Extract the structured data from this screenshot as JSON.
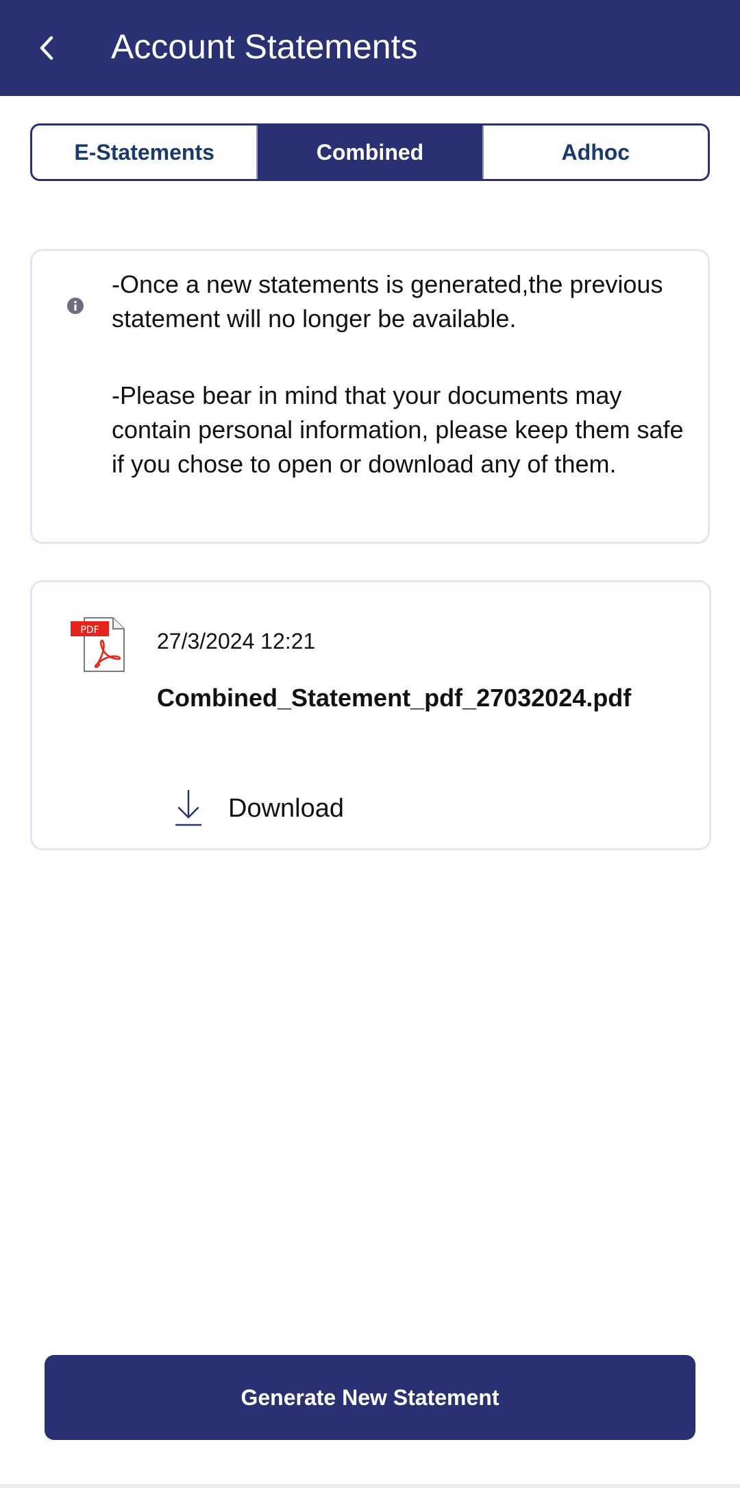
{
  "header": {
    "title": "Account Statements",
    "back_icon": "chevron-left-icon",
    "background": "#2a3172"
  },
  "tabs": [
    {
      "label": "E-Statements",
      "active": false
    },
    {
      "label": "Combined",
      "active": true
    },
    {
      "label": "Adhoc",
      "active": false
    }
  ],
  "notice": {
    "icon": "info-icon",
    "paragraphs": [
      "-Once a new statements is generated,the previous statement will no longer be available.",
      "-Please bear in mind that your documents may contain personal information, please keep them safe if you chose to open or download any of them."
    ]
  },
  "statement": {
    "file_icon": "pdf-icon",
    "file_icon_badge": "PDF",
    "date": "27/3/2024 12:21",
    "file_name": "Combined_Statement_pdf_27032024.pdf",
    "download_label": "Download",
    "download_icon": "download-icon"
  },
  "footer": {
    "generate_label": "Generate New Statement"
  },
  "colors": {
    "primary": "#2a3172",
    "tab_text": "#1a3a6b",
    "card_border": "#e1e7ef",
    "pdf_red": "#e5251b"
  }
}
